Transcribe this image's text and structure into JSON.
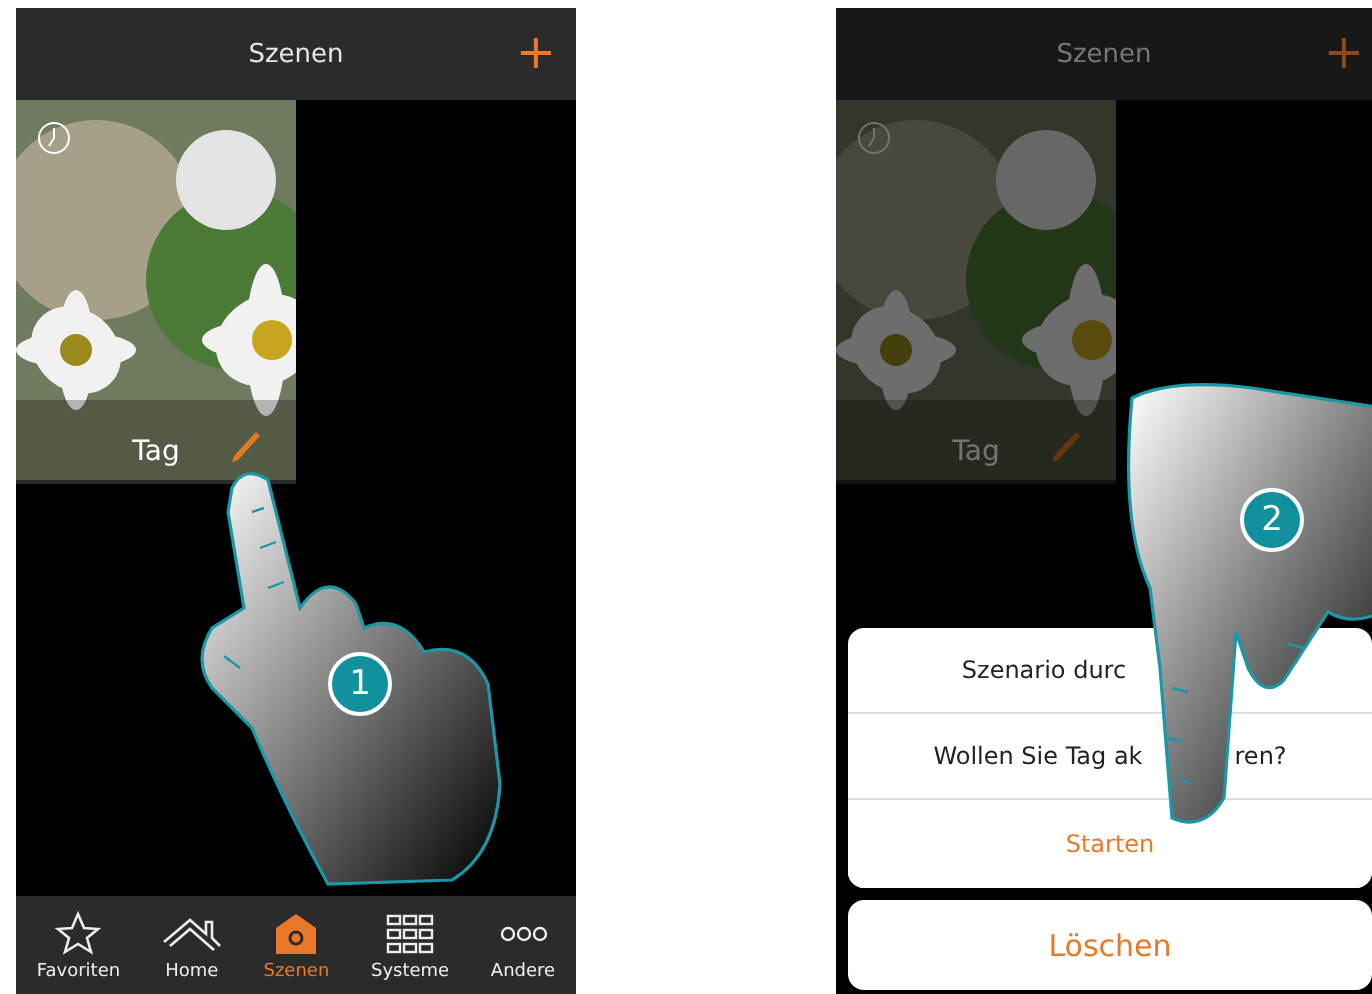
{
  "screens": [
    {
      "dimmed": false,
      "header": {
        "title": "Szenen",
        "add": "+"
      },
      "tiles": [
        {
          "label": "Tag",
          "scheduled": true
        }
      ],
      "nav": [
        {
          "label": "Favoriten",
          "kind": "star",
          "selected": false
        },
        {
          "label": "Home",
          "kind": "house",
          "selected": false
        },
        {
          "label": "Szenen",
          "kind": "scene",
          "selected": true
        },
        {
          "label": "Systeme",
          "kind": "grid",
          "selected": false
        },
        {
          "label": "Andere",
          "kind": "dots",
          "selected": false
        }
      ],
      "hand": {
        "step": "1",
        "kind": "single"
      }
    },
    {
      "dimmed": true,
      "header": {
        "title": "Szenen",
        "add": "+"
      },
      "tiles": [
        {
          "label": "Tag",
          "scheduled": true
        }
      ],
      "dialog": {
        "title_parts": [
          "Szenario durc"
        ],
        "message_parts": [
          "Wollen Sie Tag ak",
          "ren?"
        ],
        "action": "Starten",
        "delete": "Löschen"
      },
      "hand": {
        "step": "2",
        "kind": "double"
      }
    }
  ]
}
